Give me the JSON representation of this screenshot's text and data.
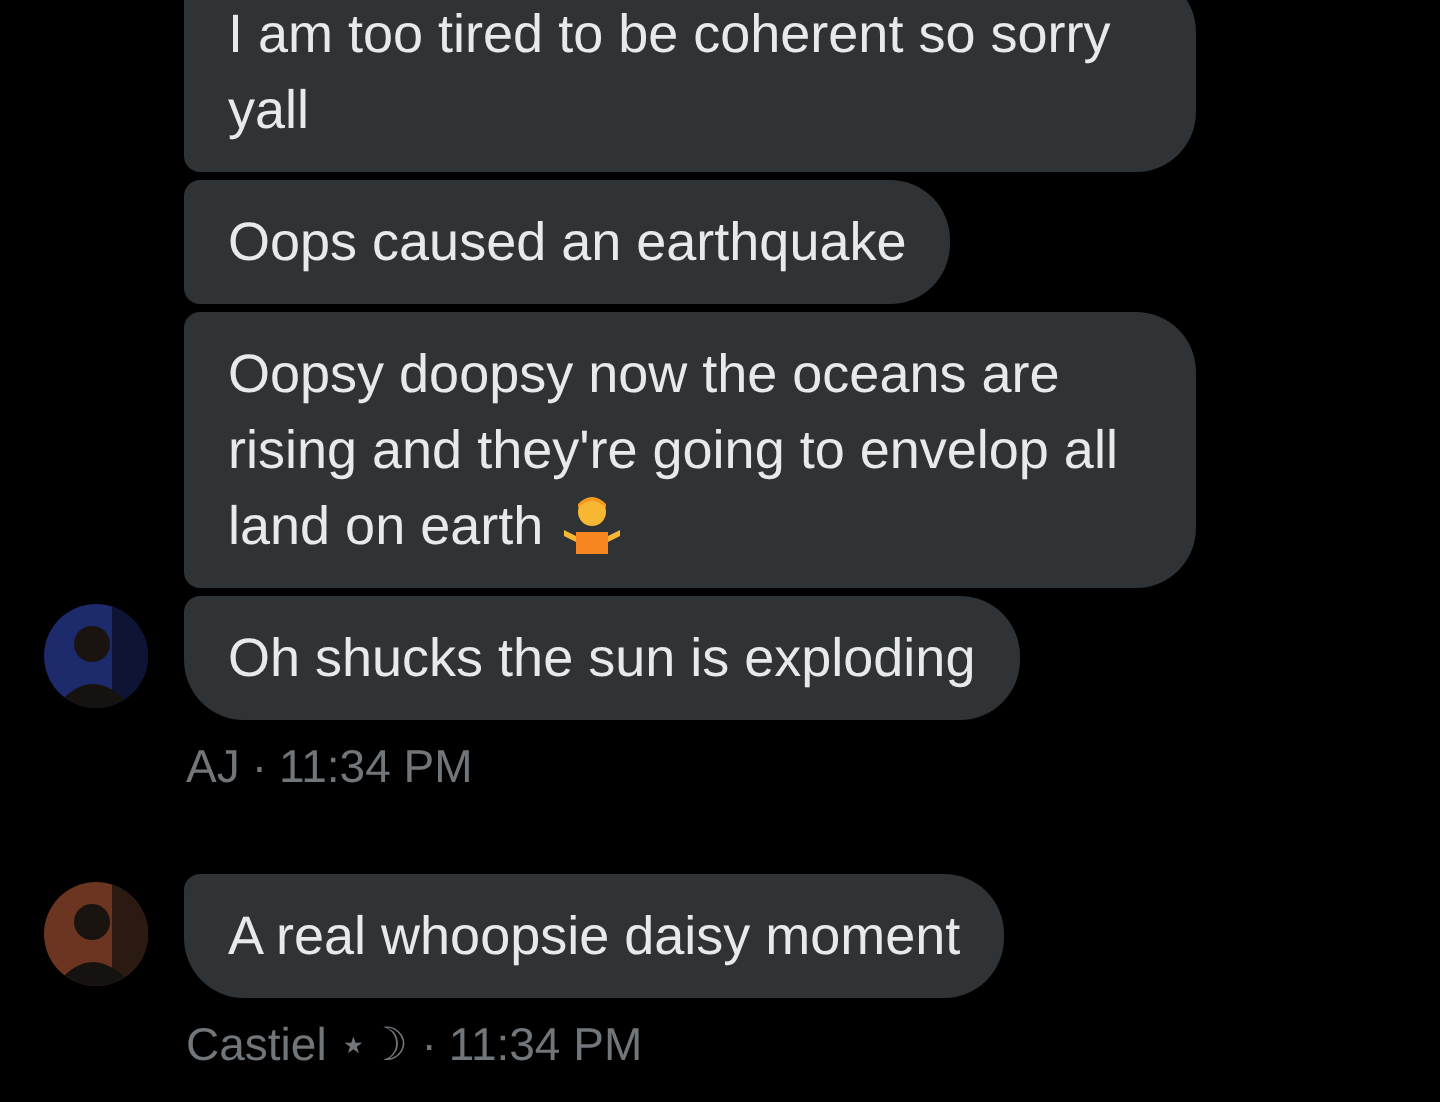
{
  "groups": [
    {
      "avatar": {
        "kind": "picture"
      },
      "messages": [
        {
          "kind": "text",
          "text": "I am too tired to be coherent so sorry yall"
        },
        {
          "kind": "text",
          "text": "Oops caused an earthquake"
        },
        {
          "kind": "shrug-emoji",
          "text": "Oopsy doopsy now the oceans are rising and they're going to envelop all land on earth"
        },
        {
          "kind": "text",
          "text": "Oh shucks the sun is exploding"
        }
      ],
      "sender": "AJ",
      "separator": "·",
      "time": "11:34 PM"
    },
    {
      "avatar": {
        "kind": "picture"
      },
      "messages": [
        {
          "kind": "text",
          "text": "A real whoopsie daisy moment"
        }
      ],
      "sender": "Castiel ⋆☽",
      "separator": "·",
      "time": "11:34 PM"
    }
  ]
}
